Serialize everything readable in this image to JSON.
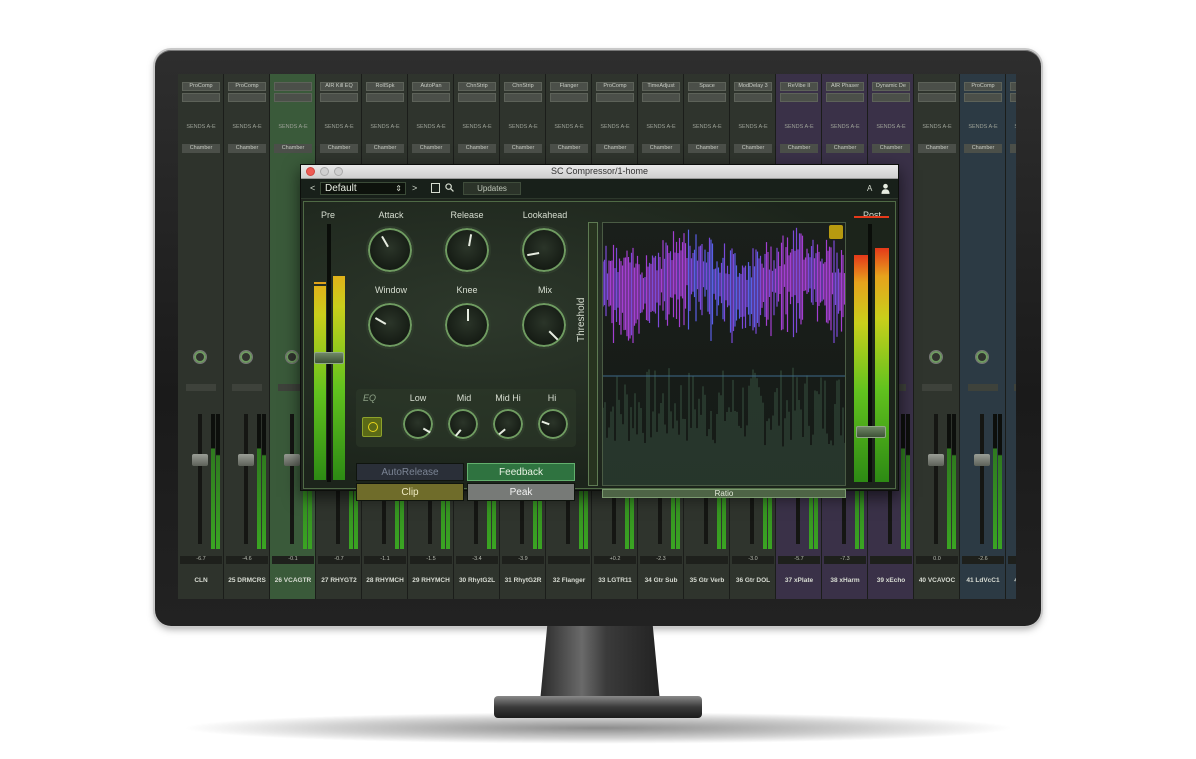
{
  "window": {
    "title": "SC Compressor/1-home"
  },
  "toolbar": {
    "prev": "<",
    "preset": "Default",
    "next": ">",
    "updates": "Updates",
    "ab": "A"
  },
  "meters": {
    "pre_label": "Pre",
    "post_label": "Post"
  },
  "knobs": [
    {
      "label": "Attack"
    },
    {
      "label": "Release"
    },
    {
      "label": "Lookahead"
    },
    {
      "label": "Window"
    },
    {
      "label": "Knee"
    },
    {
      "label": "Mix"
    }
  ],
  "eq": {
    "label": "EQ",
    "bands": [
      "Low",
      "Mid",
      "Mid Hi",
      "Hi"
    ]
  },
  "buttons": {
    "autorelease": "AutoRelease",
    "feedback": "Feedback",
    "clip": "Clip",
    "peak": "Peak"
  },
  "graph": {
    "threshold": "Threshold",
    "ratio": "Ratio"
  },
  "colors": {
    "accent_green": "#62b06d",
    "waveform_purple": "#a33fd1",
    "waveform_blue": "#4a59e0",
    "clip_olive": "#6f6c2a"
  },
  "mixer": {
    "sends_label": "SENDS A-E",
    "chamber_label": "Chamber",
    "strips": [
      {
        "name": "CLN",
        "ins": "ProComp",
        "vol": "-6.7"
      },
      {
        "name": "25 DRMCRS",
        "ins": "ProComp",
        "vol": "-4.6"
      },
      {
        "name": "26 VCAGTR",
        "ins": "",
        "vol": "-0.1"
      },
      {
        "name": "27 RHYGT2",
        "ins": "AIR Kill EQ",
        "vol": "-0.7"
      },
      {
        "name": "28 RHYMCH",
        "ins": "RollSpk",
        "vol": "-1.1"
      },
      {
        "name": "29 RHYMCH",
        "ins": "AutoPan",
        "vol": "-1.5"
      },
      {
        "name": "30 RhytG2L",
        "ins": "ChnStrip",
        "vol": "-3.4"
      },
      {
        "name": "31 RhytG2R",
        "ins": "ChnStrip",
        "vol": "-3.9"
      },
      {
        "name": "32 Flanger",
        "ins": "Flanger",
        "vol": ""
      },
      {
        "name": "33 LGTR11",
        "ins": "ProComp",
        "vol": "+0.2"
      },
      {
        "name": "34 Gtr Sub",
        "ins": "TimeAdjust",
        "vol": "-2.3"
      },
      {
        "name": "35 Gtr Verb",
        "ins": "Space",
        "vol": ""
      },
      {
        "name": "36 Gtr DOL",
        "ins": "ModDelay 3",
        "vol": "-3.0"
      },
      {
        "name": "37 xPlate",
        "ins": "ReVibe II",
        "vol": "-5.7"
      },
      {
        "name": "38 xHarm",
        "ins": "AIR Phaser",
        "vol": "-7.3"
      },
      {
        "name": "39 xEcho",
        "ins": "Dynamic De",
        "vol": ""
      },
      {
        "name": "40 VCAVOC",
        "ins": "",
        "vol": "0.0"
      },
      {
        "name": "41 LdVcC1",
        "ins": "ProComp",
        "vol": "-2.6"
      },
      {
        "name": "42 LdVcC",
        "ins": "",
        "vol": ""
      }
    ]
  }
}
